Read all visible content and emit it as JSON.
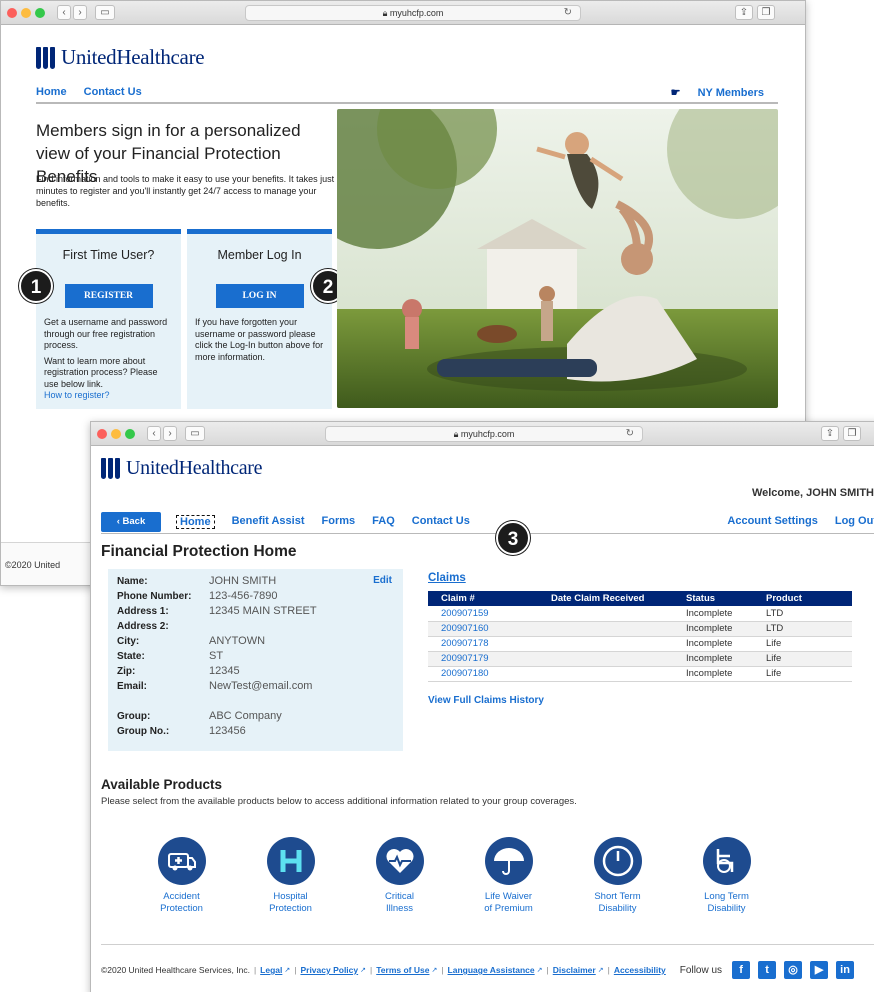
{
  "window1": {
    "url": "myuhcfp.com",
    "logo": "UnitedHealthcare",
    "nav": [
      "Home",
      "Contact Us"
    ],
    "ny_members": "NY Members",
    "hero_title": "Members sign in for a personalized view of your Financial Protection Benefits",
    "hero_desc": "Find information and tools to make it easy to use your benefits. It takes just minutes to register and you'll instantly get 24/7 access to manage your benefits.",
    "first_time": {
      "title": "First Time User?",
      "button": "REGISTER",
      "text1": "Get a username and password through our free registration process.",
      "text2": "Want to learn more about registration process? Please use below link.",
      "link": "How to register?"
    },
    "member_login": {
      "title": "Member Log In",
      "button": "LOG IN",
      "text1": "If you have forgotten your username or password please click the Log-In button above for more information."
    },
    "badges": [
      "1",
      "2"
    ],
    "footer": "©2020 United"
  },
  "window2": {
    "url": "myuhcfp.com",
    "logo": "UnitedHealthcare",
    "welcome": "Welcome, JOHN SMITH",
    "back": "‹ Back",
    "nav": [
      "Home",
      "Benefit Assist",
      "Forms",
      "FAQ",
      "Contact Us"
    ],
    "account": [
      "Account Settings",
      "Log Out"
    ],
    "badge": "3",
    "page_title": "Financial Protection Home",
    "edit": "Edit",
    "info": [
      {
        "label": "Name:",
        "value": "JOHN SMITH"
      },
      {
        "label": "Phone Number:",
        "value": "123-456-7890"
      },
      {
        "label": "Address 1:",
        "value": "12345 MAIN STREET"
      },
      {
        "label": "Address 2:",
        "value": ""
      },
      {
        "label": "City:",
        "value": "ANYTOWN"
      },
      {
        "label": "State:",
        "value": "ST"
      },
      {
        "label": "Zip:",
        "value": "12345"
      },
      {
        "label": "Email:",
        "value": "NewTest@email.com"
      },
      {
        "label": "",
        "value": ""
      },
      {
        "label": "Group:",
        "value": "ABC Company"
      },
      {
        "label": "Group No.:",
        "value": "123456"
      }
    ],
    "claims_heading": "Claims",
    "claims_columns": [
      "Claim #",
      "Date Claim Received",
      "Status",
      "Product"
    ],
    "claims": [
      {
        "claim": "200907159",
        "date": "",
        "status": "Incomplete",
        "product": "LTD"
      },
      {
        "claim": "200907160",
        "date": "",
        "status": "Incomplete",
        "product": "LTD"
      },
      {
        "claim": "200907178",
        "date": "",
        "status": "Incomplete",
        "product": "Life"
      },
      {
        "claim": "200907179",
        "date": "",
        "status": "Incomplete",
        "product": "Life"
      },
      {
        "claim": "200907180",
        "date": "",
        "status": "Incomplete",
        "product": "Life"
      }
    ],
    "view_full": "View Full Claims History",
    "available_heading": "Available Products",
    "available_desc": "Please select from the available products below to access additional information related to your group coverages.",
    "products": [
      {
        "line1": "Accident",
        "line2": "Protection",
        "icon": "ambulance-icon"
      },
      {
        "line1": "Hospital",
        "line2": "Protection",
        "icon": "hospital-icon"
      },
      {
        "line1": "Critical",
        "line2": "Illness",
        "icon": "heart-icon"
      },
      {
        "line1": "Life Waiver",
        "line2": "of Premium",
        "icon": "umbrella-icon"
      },
      {
        "line1": "Short Term",
        "line2": "Disability",
        "icon": "clock-icon"
      },
      {
        "line1": "Long Term",
        "line2": "Disability",
        "icon": "wheelchair-icon"
      }
    ],
    "footer": {
      "copyright": "©2020 United Healthcare Services, Inc.",
      "links": [
        "Legal",
        "Privacy Policy",
        "Terms of Use",
        "Language Assistance",
        "Disclaimer",
        "Accessibility"
      ],
      "follow": "Follow us",
      "social": [
        "f",
        "t",
        "◎",
        "▶",
        "in"
      ]
    }
  }
}
